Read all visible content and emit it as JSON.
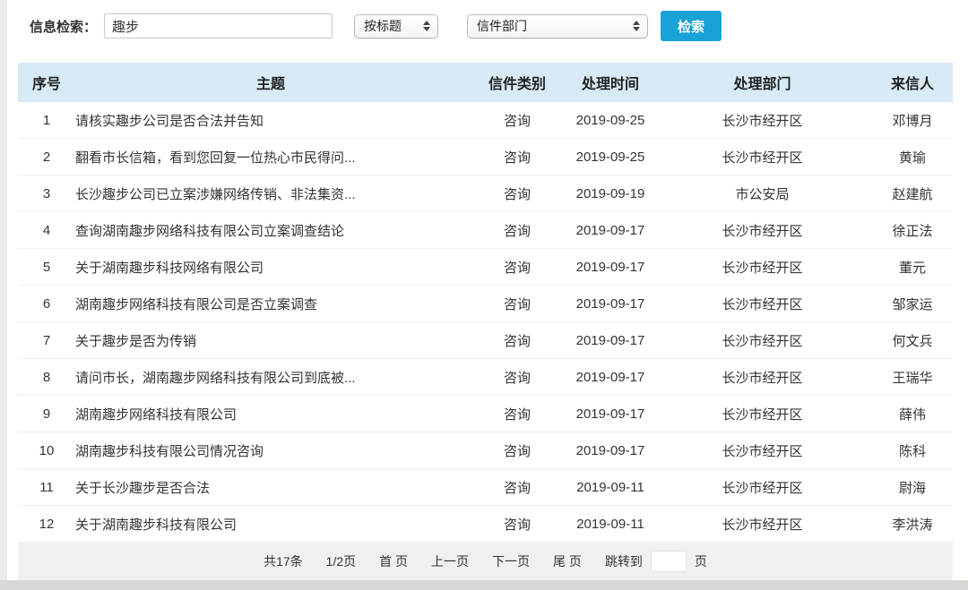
{
  "search_bar": {
    "label": "信息检索：",
    "input_value": "趣步",
    "field_select_value": "按标题",
    "dept_select_value": "信件部门",
    "search_button_label": "检索",
    "button_color": "#18a2d6"
  },
  "table": {
    "headers": [
      "序号",
      "主题",
      "信件类别",
      "处理时间",
      "处理部门",
      "来信人"
    ],
    "header_bg": "#d7eaf6",
    "rows": [
      {
        "no": "1",
        "subject": "请核实趣步公司是否合法并告知",
        "category": "咨询",
        "date": "2019-09-25",
        "dept": "长沙市经开区",
        "sender": "邓博月"
      },
      {
        "no": "2",
        "subject": "翻看市长信箱，看到您回复一位热心市民得问...",
        "category": "咨询",
        "date": "2019-09-25",
        "dept": "长沙市经开区",
        "sender": "黄瑜"
      },
      {
        "no": "3",
        "subject": "长沙趣步公司已立案涉嫌网络传销、非法集资...",
        "category": "咨询",
        "date": "2019-09-19",
        "dept": "市公安局",
        "sender": "赵建航"
      },
      {
        "no": "4",
        "subject": "查询湖南趣步网络科技有限公司立案调查结论",
        "category": "咨询",
        "date": "2019-09-17",
        "dept": "长沙市经开区",
        "sender": "徐正法"
      },
      {
        "no": "5",
        "subject": "关于湖南趣步科技网络有限公司",
        "category": "咨询",
        "date": "2019-09-17",
        "dept": "长沙市经开区",
        "sender": "董元"
      },
      {
        "no": "6",
        "subject": "湖南趣步网络科技有限公司是否立案调查",
        "category": "咨询",
        "date": "2019-09-17",
        "dept": "长沙市经开区",
        "sender": "邹家运"
      },
      {
        "no": "7",
        "subject": "关于趣步是否为传销",
        "category": "咨询",
        "date": "2019-09-17",
        "dept": "长沙市经开区",
        "sender": "何文兵"
      },
      {
        "no": "8",
        "subject": "请问市长，湖南趣步网络科技有限公司到底被...",
        "category": "咨询",
        "date": "2019-09-17",
        "dept": "长沙市经开区",
        "sender": "王瑞华"
      },
      {
        "no": "9",
        "subject": "湖南趣步网络科技有限公司",
        "category": "咨询",
        "date": "2019-09-17",
        "dept": "长沙市经开区",
        "sender": "薛伟"
      },
      {
        "no": "10",
        "subject": "湖南趣步科技有限公司情况咨询",
        "category": "咨询",
        "date": "2019-09-17",
        "dept": "长沙市经开区",
        "sender": "陈科"
      },
      {
        "no": "11",
        "subject": "关于长沙趣步是否合法",
        "category": "咨询",
        "date": "2019-09-11",
        "dept": "长沙市经开区",
        "sender": "尉海"
      },
      {
        "no": "12",
        "subject": "关于湖南趣步科技有限公司",
        "category": "咨询",
        "date": "2019-09-11",
        "dept": "长沙市经开区",
        "sender": "李洪涛"
      }
    ]
  },
  "pagination": {
    "total_label": "共17条",
    "page_indicator": "1/2页",
    "first_label": "首 页",
    "prev_label": "上一页",
    "next_label": "下一页",
    "last_label": "尾 页",
    "jump_label": "跳转到",
    "jump_input_value": "",
    "page_suffix": "页"
  }
}
